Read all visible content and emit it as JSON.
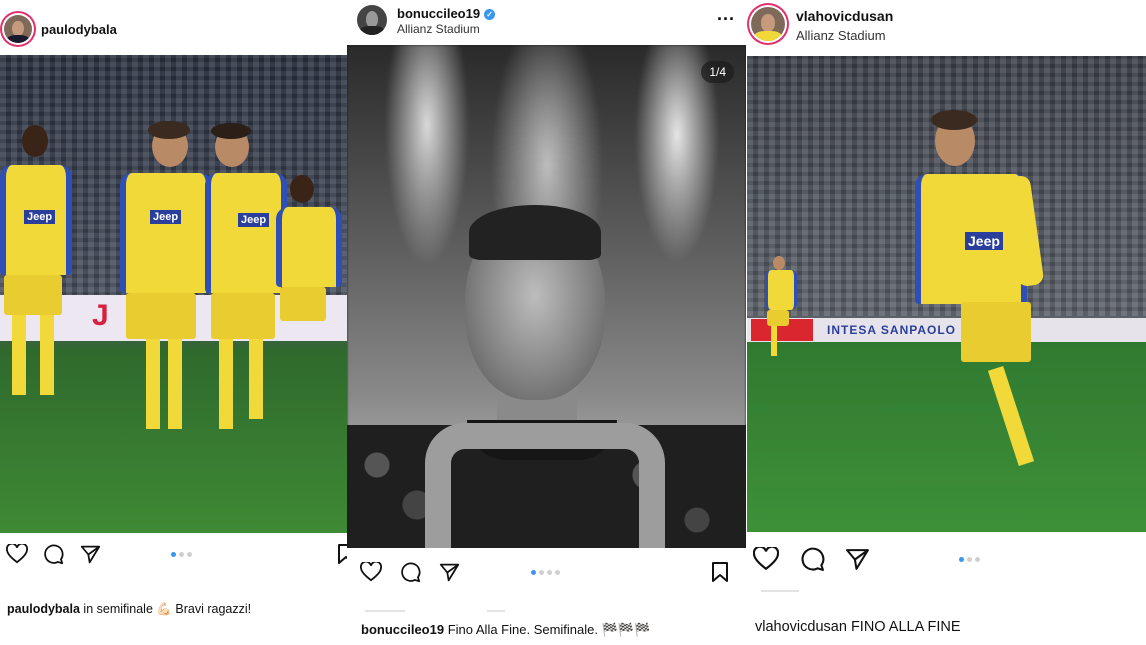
{
  "posts": [
    {
      "username": "paulodybala",
      "location": "",
      "caption_user": "paulodybala",
      "caption_text": "in semifinale 💪🏻 Bravi ragazzi!",
      "carousel_total": 3,
      "carousel_active": 1,
      "jersey_text": "Jeep"
    },
    {
      "username": "bonucci­leo19",
      "verified": true,
      "location": "Allianz Stadium",
      "caption_user": "bonuccileo19",
      "caption_text": "Fino Alla Fine. Semifinale. 🏁🏁🏁",
      "photo_counter": "1/4",
      "more_label": "...",
      "carousel_total": 4,
      "carousel_active": 1
    },
    {
      "username": "vlahovicdusan",
      "location": "Allianz Stadium",
      "caption_user": "vlahovicdusan",
      "caption_text": "FINO ALLA FINE",
      "carousel_total": 3,
      "carousel_active": 1,
      "jersey_text": "Jeep",
      "board_text": "INTESA SANPAOLO"
    }
  ],
  "icons": [
    "heart-icon",
    "comment-icon",
    "share-icon",
    "save-icon",
    "tag-user-icon",
    "verified-icon"
  ],
  "colors": {
    "accent": "#3897f0",
    "story_ring": "#e1306c",
    "pitch": "#3e9038",
    "kit_yellow": "#f1d93a",
    "kit_blue": "#2f4fb8"
  }
}
